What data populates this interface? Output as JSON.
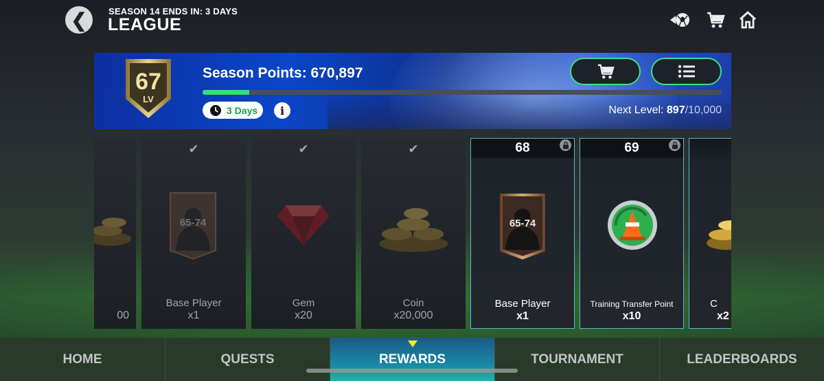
{
  "header": {
    "season_ends": "SEASON 14 ENDS IN: 3 DAYS",
    "title": "LEAGUE",
    "back_icon": "chevron-left-icon",
    "icons": [
      "football-icon",
      "cart-icon",
      "home-icon"
    ]
  },
  "banner": {
    "level": "67",
    "level_label": "LV",
    "season_points_label": "Season Points: 670,897",
    "progress": 0.09,
    "days_left": "3 Days",
    "info_glyph": "i",
    "next_level_label": "Next Level: ",
    "next_level_current": "897",
    "next_level_max": "/10,000",
    "buttons": [
      "cart-icon",
      "list-icon"
    ]
  },
  "cards": [
    {
      "name": "",
      "qty": "00",
      "type": "coin",
      "state": "claimed"
    },
    {
      "name": "Base Player",
      "qty": "x1",
      "type": "player",
      "range": "65-74",
      "state": "claimed"
    },
    {
      "name": "Gem",
      "qty": "x20",
      "type": "gem",
      "state": "claimed"
    },
    {
      "name": "Coin",
      "qty": "x20,000",
      "type": "coin",
      "state": "claimed"
    },
    {
      "level": "68",
      "name": "Base Player",
      "qty": "x1",
      "type": "player",
      "range": "65-74",
      "state": "locked"
    },
    {
      "level": "69",
      "name": "Training Transfer Point",
      "qty": "x10",
      "type": "training",
      "state": "locked"
    },
    {
      "name": "C",
      "qty": "x2",
      "type": "coin",
      "state": "locked"
    }
  ],
  "nav": {
    "tabs": [
      "HOME",
      "QUESTS",
      "REWARDS",
      "TOURNAMENT",
      "LEADERBOARDS"
    ],
    "active": "REWARDS"
  },
  "colors": {
    "accent_green": "#33e07a",
    "active_tab": "#1a8aa6",
    "indicator": "#f3ea2c"
  }
}
